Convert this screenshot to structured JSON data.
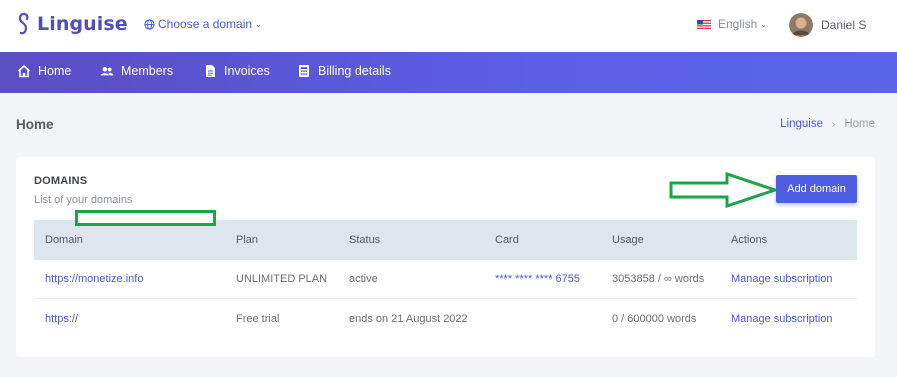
{
  "brand": {
    "name": "Linguise"
  },
  "header": {
    "domain_select": "Choose a domain",
    "language": "English",
    "user_name": "Daniel S"
  },
  "nav": {
    "home": "Home",
    "members": "Members",
    "invoices": "Invoices",
    "billing": "Billing details"
  },
  "page": {
    "title": "Home",
    "breadcrumb": [
      "Linguise",
      "Home"
    ]
  },
  "domains": {
    "title": "DOMAINS",
    "subtitle": "List of your domains",
    "add_button": "Add domain",
    "columns": [
      "Domain",
      "Plan",
      "Status",
      "Card",
      "Usage",
      "Actions"
    ],
    "rows": [
      {
        "domain": "https://monetize.info",
        "plan": "UNLIMITED PLAN",
        "status": "active",
        "card": "**** **** **** 6755",
        "usage": "3053858 / ∞ words",
        "action": "Manage subscription"
      },
      {
        "domain": "https://",
        "plan": "Free trial",
        "status": "ends on 21 August 2022",
        "card": "",
        "usage": "0 / 600000 words",
        "action": "Manage subscription"
      }
    ]
  },
  "colors": {
    "accent": "#4d5ee3",
    "nav_start": "#5b4dc2",
    "nav_end": "#5a63ea",
    "annotation": "#1aa54a"
  },
  "icons": [
    "linguise-logo-icon",
    "globe-icon",
    "chevron-down-icon",
    "us-flag-icon",
    "home-icon",
    "members-icon",
    "invoice-icon",
    "billing-icon",
    "chevron-right-icon"
  ]
}
